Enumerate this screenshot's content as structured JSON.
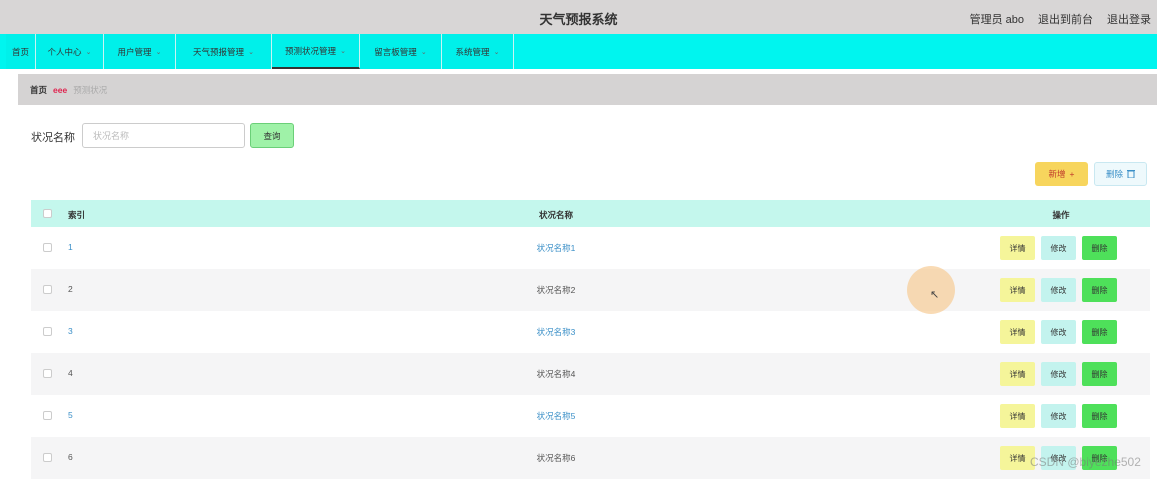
{
  "header": {
    "title": "天气预报系统",
    "admin": "管理员 abo",
    "to_front": "退出到前台",
    "logout": "退出登录"
  },
  "nav": [
    {
      "label": "首页",
      "caret": false
    },
    {
      "label": "个人中心",
      "caret": true
    },
    {
      "label": "用户管理",
      "caret": true
    },
    {
      "label": "天气预报管理",
      "caret": true
    },
    {
      "label": "预测状况管理",
      "caret": true,
      "active": true
    },
    {
      "label": "留言板管理",
      "caret": true
    },
    {
      "label": "系统管理",
      "caret": true
    }
  ],
  "breadcrumb": {
    "home": "首页",
    "separator": "eee",
    "current": "预测状况"
  },
  "search": {
    "label": "状况名称",
    "placeholder": "状况名称",
    "button": "查询"
  },
  "actions": {
    "add": "新增",
    "delete": "删除"
  },
  "table": {
    "headers": {
      "index": "索引",
      "name": "状况名称",
      "ops": "操作"
    },
    "rows": [
      {
        "index": "1",
        "name": "状况名称1"
      },
      {
        "index": "2",
        "name": "状况名称2"
      },
      {
        "index": "3",
        "name": "状况名称3"
      },
      {
        "index": "4",
        "name": "状况名称4"
      },
      {
        "index": "5",
        "name": "状况名称5"
      },
      {
        "index": "6",
        "name": "状况名称6"
      }
    ],
    "row_ops": {
      "detail": "详情",
      "edit": "修改",
      "delete": "删除"
    }
  },
  "watermark": "CSDN @biyezhe502",
  "colors": {
    "nav_bg": "#00f5ef",
    "header_bg": "#d8d6d6",
    "table_head_bg": "#c4f7ed",
    "add_btn": "#f7d55d",
    "delete_op": "#4ee05a"
  }
}
